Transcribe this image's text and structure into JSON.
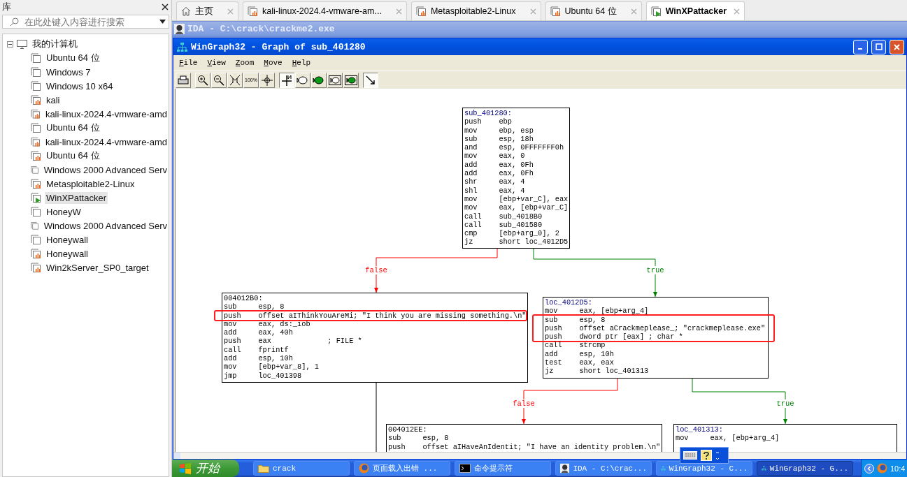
{
  "library": {
    "title": "库",
    "search": {
      "placeholder": "在此处键入内容进行搜索"
    },
    "tree": [
      {
        "label": "我的计算机",
        "expanded": true,
        "children": [
          {
            "label": "Ubuntu 64 位",
            "kind": "vm",
            "selected": false
          },
          {
            "label": "Windows 7",
            "kind": "vm",
            "selected": false
          },
          {
            "label": "Windows 10 x64",
            "kind": "vm",
            "selected": false
          },
          {
            "label": "kali",
            "kind": "vm-open",
            "selected": false
          },
          {
            "label": "kali-linux-2024.4-vmware-amd",
            "kind": "vm-open",
            "selected": false
          },
          {
            "label": "Ubuntu 64 位",
            "kind": "vm",
            "selected": false
          },
          {
            "label": "kali-linux-2024.4-vmware-amd",
            "kind": "vm-open",
            "selected": false
          },
          {
            "label": "Ubuntu 64 位",
            "kind": "vm-open",
            "selected": false
          },
          {
            "label": "Windows 2000 Advanced Serv",
            "kind": "vm",
            "selected": false
          },
          {
            "label": "Metasploitable2-Linux",
            "kind": "vm-open",
            "selected": false
          },
          {
            "label": "WinXPattacker",
            "kind": "vm-running",
            "selected": true
          },
          {
            "label": "HoneyW",
            "kind": "vm",
            "selected": false
          },
          {
            "label": "Windows 2000 Advanced Serv",
            "kind": "vm",
            "selected": false
          },
          {
            "label": "Honeywall",
            "kind": "vm",
            "selected": false
          },
          {
            "label": "Honeywall",
            "kind": "vm-open",
            "selected": false
          },
          {
            "label": "Win2kServer_SP0_target",
            "kind": "vm-open",
            "selected": false
          }
        ]
      }
    ]
  },
  "tabs": [
    {
      "label": "主页",
      "kind": "home",
      "selected": false
    },
    {
      "label": "kali-linux-2024.4-vmware-am...",
      "kind": "vm-open",
      "selected": false
    },
    {
      "label": "Metasploitable2-Linux",
      "kind": "vm-open",
      "selected": false
    },
    {
      "label": "Ubuntu 64 位",
      "kind": "vm-open",
      "selected": false
    },
    {
      "label": "WinXPattacker",
      "kind": "vm-running",
      "selected": true
    }
  ],
  "ida_window": {
    "title": "IDA - C:\\crack\\crackme2.exe"
  },
  "graph_window": {
    "title": "WinGraph32 - Graph of sub_401280",
    "menu": [
      "File",
      "View",
      "Zoom",
      "Move",
      "Help"
    ],
    "toolbar": [
      [
        {
          "kind": "print",
          "pressed": false
        }
      ],
      [
        {
          "kind": "zoom-in",
          "pressed": false
        },
        {
          "kind": "zoom-out",
          "pressed": false
        },
        {
          "kind": "fit",
          "pressed": false
        },
        {
          "kind": "zoom-100",
          "label": "100%",
          "pressed": false
        },
        {
          "kind": "center",
          "pressed": false
        }
      ],
      [
        {
          "kind": "north",
          "pressed": true
        },
        {
          "kind": "fish",
          "pressed": false
        },
        {
          "kind": "fish-green",
          "pressed": false
        },
        {
          "kind": "fish-box",
          "pressed": false
        },
        {
          "kind": "fish-box-green",
          "pressed": false
        }
      ],
      [
        {
          "kind": "follow",
          "pressed": true
        }
      ]
    ],
    "nodes": [
      {
        "label": "sub_401280:",
        "kind": "name",
        "lines": [
          {
            "text": "push    ebp",
            "highlighted": false
          },
          {
            "text": "mov     ebp, esp",
            "highlighted": false
          },
          {
            "text": "sub     esp, 18h",
            "highlighted": false
          },
          {
            "text": "and     esp, 0FFFFFFF0h",
            "highlighted": false
          },
          {
            "text": "mov     eax, 0",
            "highlighted": false
          },
          {
            "text": "add     eax, 0Fh",
            "highlighted": false
          },
          {
            "text": "add     eax, 0Fh",
            "highlighted": false
          },
          {
            "text": "shr     eax, 4",
            "highlighted": false
          },
          {
            "text": "shl     eax, 4",
            "highlighted": false
          },
          {
            "text": "mov     [ebp+var_C], eax",
            "highlighted": false
          },
          {
            "text": "mov     eax, [ebp+var_C]",
            "highlighted": false
          },
          {
            "text": "call    sub_4018B0",
            "highlighted": false
          },
          {
            "text": "call    sub_401580",
            "highlighted": false
          },
          {
            "text": "cmp     [ebp+arg_0], 2",
            "highlighted": false
          },
          {
            "text": "jz      short loc_4012D5",
            "highlighted": false
          }
        ]
      },
      {
        "label": "004012B0:",
        "kind": "address",
        "lines": [
          {
            "text": "sub     esp, 8",
            "highlighted": false
          },
          {
            "text": "push    offset aIThinkYouAreMi; \"I think you are missing something.\\n\"",
            "highlighted": true
          },
          {
            "text": "mov     eax, ds:_iob",
            "highlighted": false
          },
          {
            "text": "add     eax, 40h",
            "highlighted": false
          },
          {
            "text": "push    eax             ; FILE *",
            "highlighted": false
          },
          {
            "text": "call    fprintf",
            "highlighted": false
          },
          {
            "text": "add     esp, 10h",
            "highlighted": false
          },
          {
            "text": "mov     [ebp+var_8], 1",
            "highlighted": false
          },
          {
            "text": "jmp     loc_401398",
            "highlighted": false
          }
        ]
      },
      {
        "label": "loc_4012D5:",
        "kind": "name",
        "lines": [
          {
            "text": "mov     eax, [ebp+arg_4]",
            "highlighted": false
          },
          {
            "text": "sub     esp, 8",
            "highlighted": true
          },
          {
            "text": "push    offset aCrackmeplease_; \"crackmeplease.exe\"",
            "highlighted": true
          },
          {
            "text": "push    dword ptr [eax] ; char *",
            "highlighted": true
          },
          {
            "text": "call    strcmp",
            "highlighted": false
          },
          {
            "text": "add     esp, 10h",
            "highlighted": false
          },
          {
            "text": "test    eax, eax",
            "highlighted": false
          },
          {
            "text": "jz      short loc_401313",
            "highlighted": false
          }
        ]
      },
      {
        "label": "004012EE:",
        "kind": "address",
        "lines": [
          {
            "text": "sub     esp, 8",
            "highlighted": false
          },
          {
            "text": "push    offset aIHaveAnIdentit; \"I have an identity problem.\\n\"",
            "highlighted": false
          }
        ]
      },
      {
        "label": "loc_401313:",
        "kind": "name",
        "lines": [
          {
            "text": "mov     eax, [ebp+arg_4]",
            "highlighted": false
          }
        ]
      }
    ],
    "edges": [
      {
        "kind": "false",
        "label": "false"
      },
      {
        "kind": "true",
        "label": "true"
      },
      {
        "kind": "false",
        "label": "false"
      },
      {
        "kind": "true",
        "label": "true"
      },
      {
        "kind": "plain"
      }
    ]
  },
  "taskbar": {
    "start": "开始",
    "items": [
      {
        "label": "crack",
        "kind": "folder",
        "selected": false
      },
      {
        "label": "页面载入出错 ...",
        "kind": "browser",
        "selected": false
      },
      {
        "label": "命令提示符",
        "kind": "console",
        "selected": false
      },
      {
        "label": "IDA - C:\\crac...",
        "kind": "ida",
        "selected": false
      },
      {
        "label": "WinGraph32 - C...",
        "kind": "graph",
        "selected": false
      },
      {
        "label": "WinGraph32 - G...",
        "kind": "graph",
        "selected": true
      }
    ],
    "clock": "10:4"
  }
}
